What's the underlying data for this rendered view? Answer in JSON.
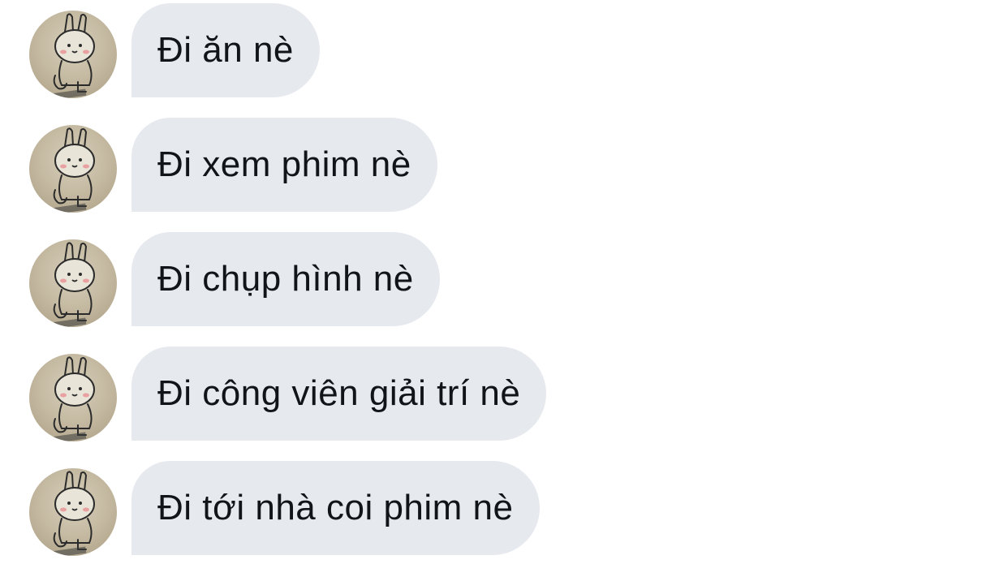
{
  "messages": [
    {
      "text": "Đi ăn nè"
    },
    {
      "text": "Đi xem phim nè"
    },
    {
      "text": "Đi chụp hình nè"
    },
    {
      "text": "Đi công viên giải trí nè"
    },
    {
      "text": "Đi tới nhà coi phim nè"
    }
  ],
  "avatar": {
    "icon": "bunny-sticker-avatar-icon",
    "colors": {
      "background": "#c2b79e",
      "line": "#2b2b2b",
      "cheek": "#e8a0a0",
      "text": "#3a3a3a"
    }
  },
  "colors": {
    "bubble": "#e6e9ee",
    "text": "#111418",
    "background": "#ffffff"
  }
}
